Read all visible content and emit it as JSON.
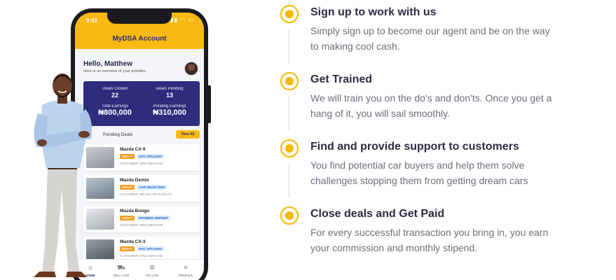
{
  "app": {
    "status_time": "9:41",
    "title": "MyDSA Account",
    "greeting": "Hello, Matthew",
    "greeting_sub": "Here is an overview of your activities",
    "stats": {
      "deals_closed_label": "Deals Closed",
      "deals_closed": "22",
      "deals_pending_label": "Deals Pending",
      "deals_pending": "13",
      "total_earnings_label": "Total Earnings",
      "total_earnings": "₦800,000",
      "pending_earnings_label": "Pending Earnings",
      "pending_earnings": "₦310,000"
    },
    "pending_deals_label": "Pending Deals",
    "view_all": "View All",
    "deals": [
      {
        "name": "Mazda CX-9",
        "status": "DRAFT",
        "stage": "DOC UPLOADS",
        "customer": "CUSTOMER: MRS ABRAHAM"
      },
      {
        "name": "Mazda Demio",
        "status": "DRAFT",
        "stage": "CAR SELECTION",
        "customer": "CUSTOMER: MR KELVIN SCHULTZ"
      },
      {
        "name": "Mazda Bongo",
        "status": "DRAFT",
        "stage": "PAYMENT DEPOSIT",
        "customer": "CUSTOMER: MRS ABRAHAM"
      },
      {
        "name": "Mazda CX-3",
        "status": "DRAFT",
        "stage": "DOC UPLOADS",
        "customer": "CUSTOMER: MRS ABRAHAM"
      }
    ],
    "tabs": [
      {
        "label": "HOME",
        "icon": "home-icon"
      },
      {
        "label": "SELL CAR",
        "icon": "car-icon"
      },
      {
        "label": "FIX CAR",
        "icon": "wrench-icon"
      },
      {
        "label": "PROFILE",
        "icon": "menu-icon"
      }
    ]
  },
  "steps": [
    {
      "title": "Sign up to work with us",
      "description": "Simply sign up to become our agent and be on the way to making cool cash."
    },
    {
      "title": "Get Trained",
      "description": "We will train you on the do's and don'ts. Once you get a hang of it, you will sail smoothly."
    },
    {
      "title": "Find and provide support to customers",
      "description": "You find potential car buyers and help them solve challenges stopping them from getting dream cars"
    },
    {
      "title": "Close deals and Get Paid",
      "description": "For every successful transaction you bring in, you earn your commission and monthly stipend."
    }
  ],
  "colors": {
    "accent": "#f6b800",
    "brand_navy": "#2d2c7d",
    "text_dark": "#2b2d42",
    "text_muted": "#6b6f7b"
  }
}
